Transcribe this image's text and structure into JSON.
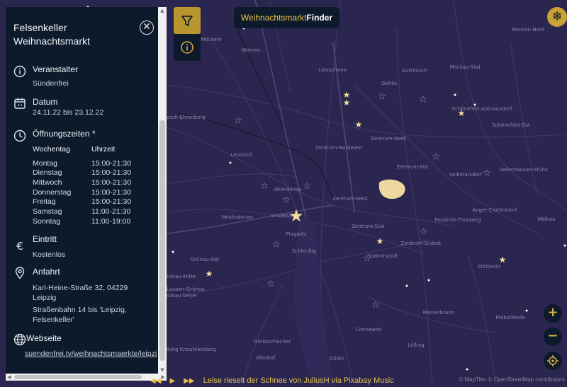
{
  "brand": {
    "part1": "Weihnachtsmarkt",
    "part2": "Finder"
  },
  "panel": {
    "title_line1": "Felsenkeller",
    "title_line2": "Weihnachtsmarkt",
    "organizer": {
      "label": "Veranstalter",
      "value": "Sündenfrei"
    },
    "date": {
      "label": "Datum",
      "value": "24.11.22 bis 23.12.22"
    },
    "hours": {
      "label": "Öffnungszeiten *",
      "col_day": "Wochentag",
      "col_time": "Uhrzeit",
      "rows": [
        {
          "day": "Montag",
          "time": "15:00-21:30"
        },
        {
          "day": "Dienstag",
          "time": "15:00-21:30"
        },
        {
          "day": "Mittwoch",
          "time": "15:00-21:30"
        },
        {
          "day": "Donnerstag",
          "time": "15:00-21:30"
        },
        {
          "day": "Freitag",
          "time": "15:00-21:30"
        },
        {
          "day": "Samstag",
          "time": "11:00-21:30"
        },
        {
          "day": "Sonntag",
          "time": "11:00-19:00"
        }
      ]
    },
    "entry": {
      "label": "Eintritt",
      "value": "Kostenlos"
    },
    "travel": {
      "label": "Anfahrt",
      "address_line1": "Karl-Heine-Straße 32, 04229",
      "address_line2": "Leipzig",
      "transit_line1": "Straßenbahn 14 bis 'Leipzig,",
      "transit_line2": "Felsenkeller'"
    },
    "website": {
      "label": "Webseite",
      "url": "suendenfrei.tv/weihnachtsmaerkte/leipzi"
    }
  },
  "map": {
    "places": [
      {
        "name": "Wahren"
      },
      {
        "name": "Möckern"
      },
      {
        "name": "Mockau-Nord"
      },
      {
        "name": "Mockau-Süd"
      },
      {
        "name": "Eutritzsch"
      },
      {
        "name": "Gohlis"
      },
      {
        "name": "Lützschena"
      },
      {
        "name": "Schönefeld-Abtnaundorf"
      },
      {
        "name": "Lützsch-Ehrenberg"
      },
      {
        "name": "Schönefeld-Ost"
      },
      {
        "name": "Zentrum-Nord"
      },
      {
        "name": "Zentrum-Nordwest"
      },
      {
        "name": "Leutzsch"
      },
      {
        "name": "Zentrum-Ost"
      },
      {
        "name": "Sellerhausen-Stünz"
      },
      {
        "name": "Volkmarsdorf"
      },
      {
        "name": "Altlindenau"
      },
      {
        "name": "Zentrum-West"
      },
      {
        "name": "Neulindenau"
      },
      {
        "name": "Lindenau"
      },
      {
        "name": "Anger-Crottendorf"
      },
      {
        "name": "Reudnitz-Thonberg"
      },
      {
        "name": "Zentrum-Süd"
      },
      {
        "name": "Mölkau"
      },
      {
        "name": "Plagwitz"
      },
      {
        "name": "Zentrum-Südost"
      },
      {
        "name": "Schleußig"
      },
      {
        "name": "Südvorstadt"
      },
      {
        "name": "Grünau-Ost"
      },
      {
        "name": "Stötteritz"
      },
      {
        "name": "Grünau-Mitte"
      },
      {
        "name": "Lausen-Grünau"
      },
      {
        "name": "Grünau Geyer"
      },
      {
        "name": "Marienbrunn"
      },
      {
        "name": "Probstheida"
      },
      {
        "name": "Connewitz"
      },
      {
        "name": "Großzschocher"
      },
      {
        "name": "Siedlung Knautkleeberg"
      },
      {
        "name": "Windorf"
      },
      {
        "name": "Dölitz"
      },
      {
        "name": "Lößnig"
      }
    ]
  },
  "footer": {
    "music_text": "Leise rieselt der Schnee von JuliusH via Pixabay Music",
    "attribution": "© MapTiler © OpenStreetMap contributors"
  },
  "colors": {
    "accent": "#c9a233",
    "panel": "#0c1a2b",
    "map": "#2b2650"
  }
}
